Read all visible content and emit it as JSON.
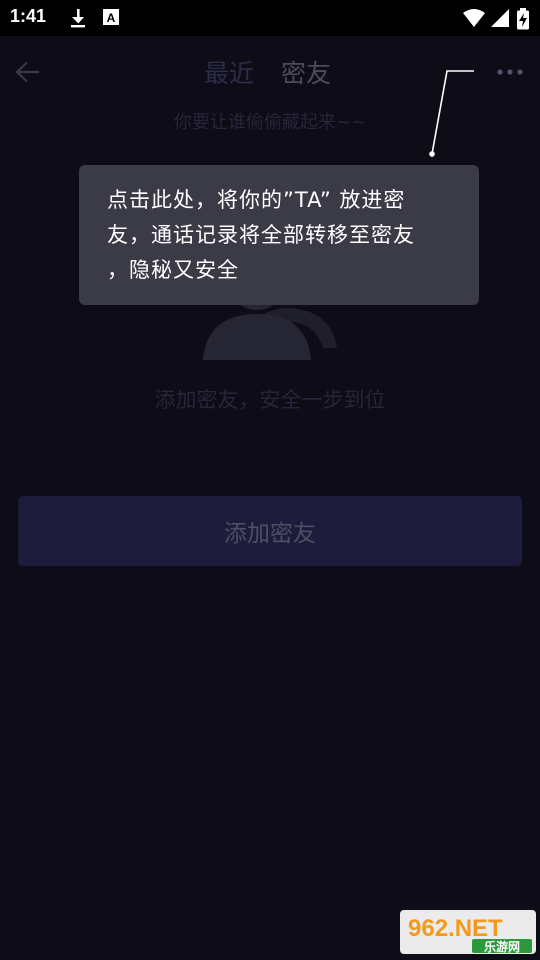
{
  "status_bar": {
    "time": "1:41",
    "icons": [
      "download-icon",
      "a-box-icon",
      "wifi-icon",
      "signal-icon",
      "battery-icon"
    ]
  },
  "header": {
    "back_icon": "arrow-left-icon",
    "tabs": [
      {
        "label": "最近",
        "active": false
      },
      {
        "label": "密友",
        "active": true
      }
    ],
    "more_icon": "more-dots-icon"
  },
  "subtitle": "你要让谁偷偷藏起来~~",
  "tooltip": {
    "lines": [
      "点击此处，将你的”TA”  放进密",
      "友，通话记录将全部转移至密友",
      "，隐秘又安全"
    ]
  },
  "empty_state": {
    "icon": "contacts-icon",
    "text": "添加密友，安全一步到位"
  },
  "add_button": {
    "label": "添加密友"
  },
  "watermark": {
    "brand": "962.NET",
    "sub": "乐游网"
  },
  "colors": {
    "background": "#0d0c17",
    "tooltip_bg": "#3b3b48",
    "button_bg": "#1e1c3c"
  }
}
